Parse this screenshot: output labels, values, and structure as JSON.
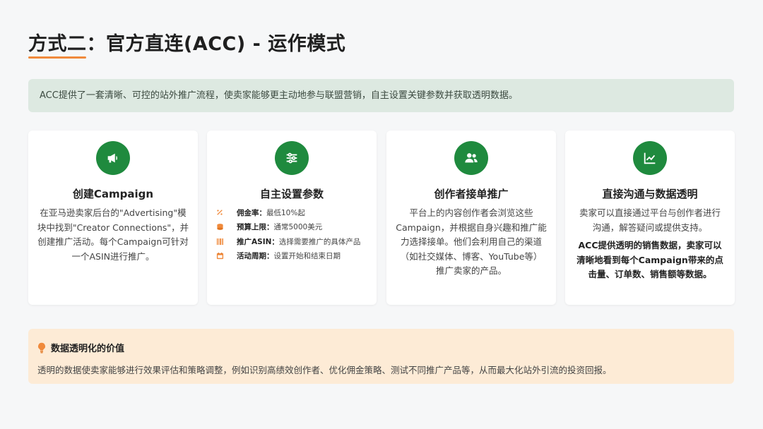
{
  "title": "方式二：官方直连(ACC) - 运作模式",
  "intro": "ACC提供了一套清晰、可控的站外推广流程，使卖家能够更主动地参与联盟营销，自主设置关键参数并获取透明数据。",
  "colors": {
    "accent_green": "#1f8a3e",
    "accent_orange": "#f08a3c",
    "intro_bg": "#dde9e1",
    "value_bg": "#fdebd6"
  },
  "cards": [
    {
      "icon": "megaphone-icon",
      "title": "创建Campaign",
      "lines": [
        "在亚马逊卖家后台的\"Advertising\"模",
        "块中找到\"Creator Connections\"，并",
        "创建推广活动。每个Campaign可针对",
        "一个ASIN进行推广。"
      ]
    },
    {
      "icon": "sliders-icon",
      "title": "自主设置参数",
      "params": [
        {
          "icon": "percent-icon",
          "label": "佣金率：",
          "value": "最低10%起"
        },
        {
          "icon": "coins-icon",
          "label": "预算上限：",
          "value": "通常5000美元"
        },
        {
          "icon": "barcode-icon",
          "label": "推广ASIN：",
          "value": "选择需要推广的具体产品"
        },
        {
          "icon": "calendar-icon",
          "label": "活动周期：",
          "value": "设置开始和结束日期"
        }
      ]
    },
    {
      "icon": "users-icon",
      "title": "创作者接单推广",
      "lines": [
        "平台上的内容创作者会浏览这些",
        "Campaign，并根据自身兴趣和推广能",
        "力选择接单。他们会利用自己的渠道",
        "（如社交媒体、博客、YouTube等）",
        "推广卖家的产品。"
      ]
    },
    {
      "icon": "chart-line-icon",
      "title": "直接沟通与数据透明",
      "lines": [
        "卖家可以直接通过平台与创作者进行",
        "沟通，解答疑问或提供支持。"
      ],
      "bold_lines": [
        "ACC提供透明的销售数据，卖家可以",
        "清晰地看到每个Campaign带来的点",
        "击量、订单数、销售额等数据。"
      ]
    }
  ],
  "value": {
    "icon": "lightbulb-icon",
    "heading": "数据透明化的价值",
    "text": "透明的数据使卖家能够进行效果评估和策略调整，例如识别高绩效创作者、优化佣金策略、测试不同推广产品等，从而最大化站外引流的投资回报。"
  }
}
